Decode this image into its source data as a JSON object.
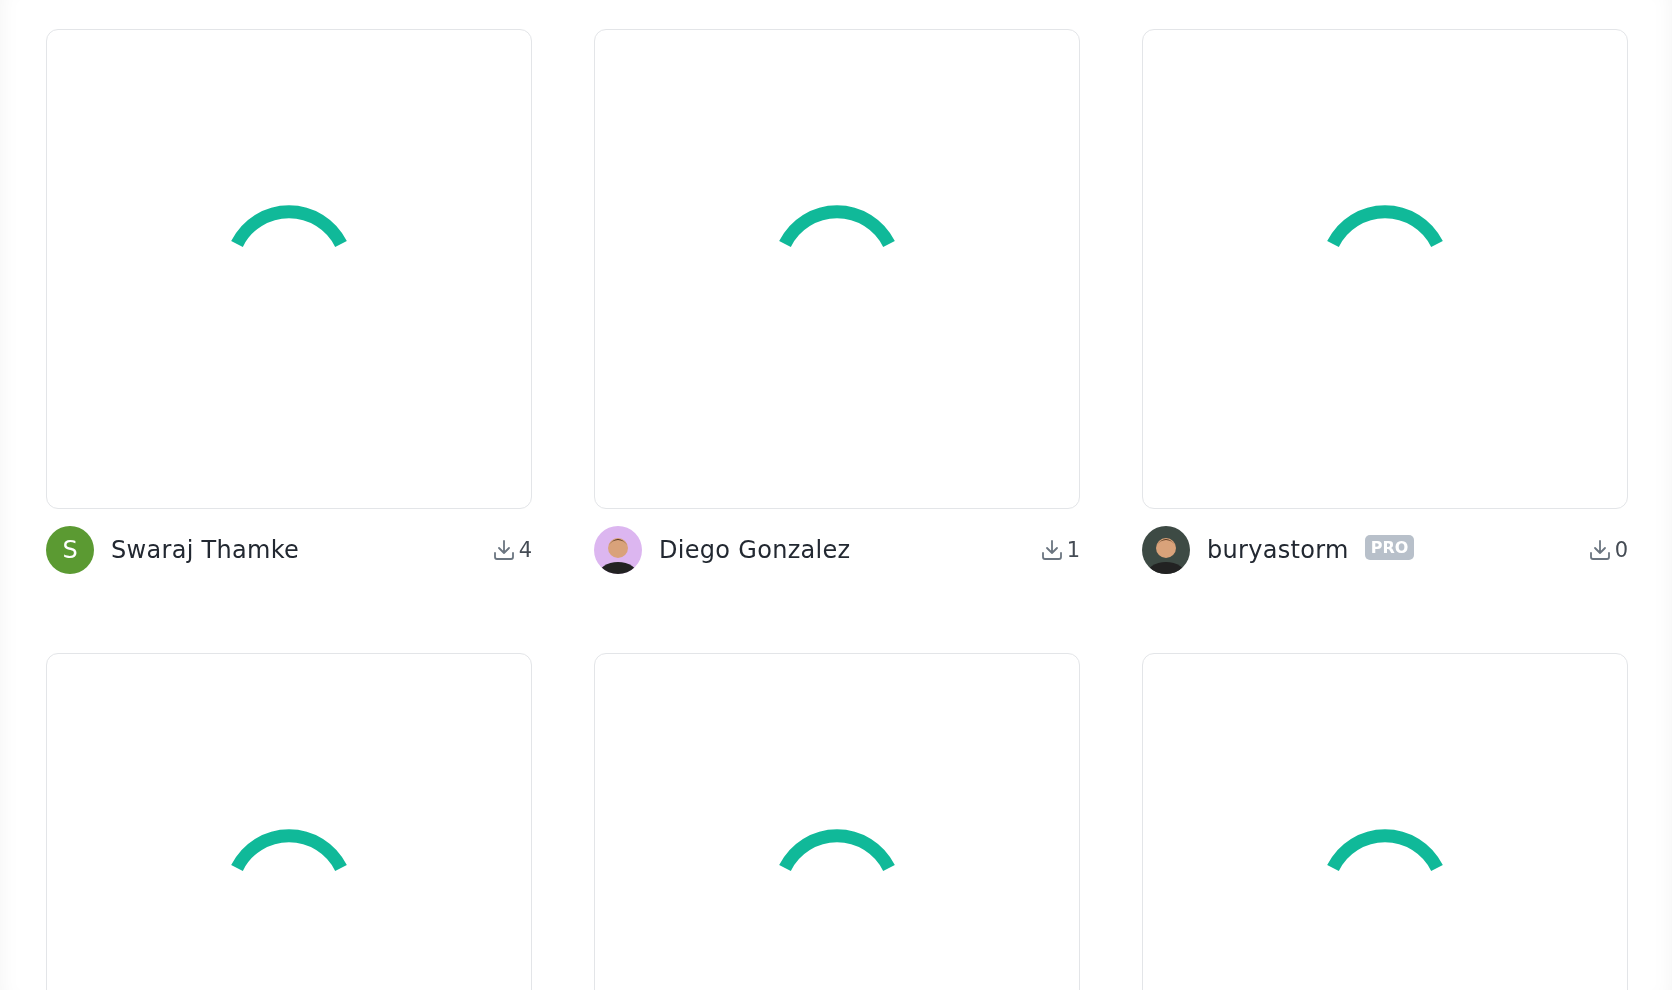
{
  "cards": [
    {
      "loading": true,
      "author": {
        "name": "Swaraj Thamke",
        "avatar": {
          "kind": "letter",
          "letter": "S",
          "color": "#5b9a32"
        },
        "downloads": "4"
      }
    },
    {
      "loading": true,
      "author": {
        "name": "Diego Gonzalez",
        "downloads": "1"
      }
    },
    {
      "loading": true,
      "author": {
        "name": "buryastorm",
        "badge": "PRO",
        "downloads": "0"
      }
    },
    {
      "loading": true
    },
    {
      "loading": true
    },
    {
      "loading": true
    }
  ]
}
